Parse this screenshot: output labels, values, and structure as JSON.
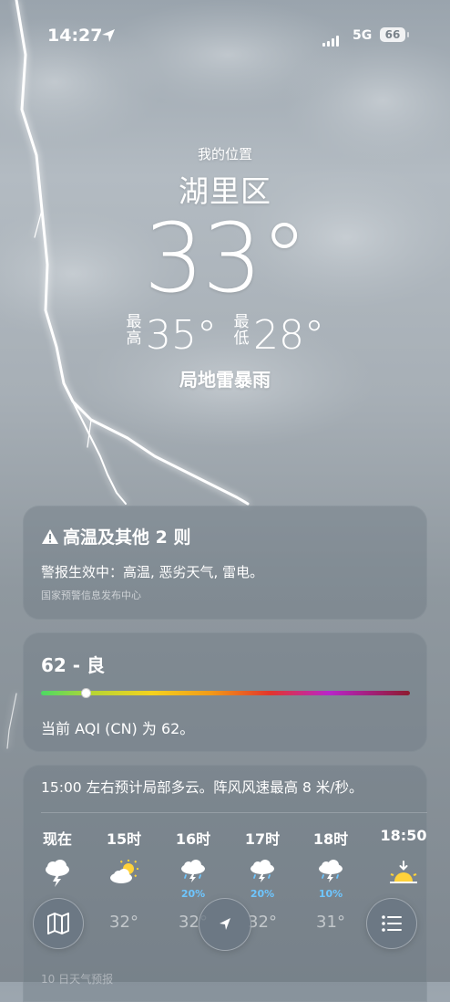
{
  "status_bar": {
    "time": "14:27",
    "network": "5G",
    "battery": "66"
  },
  "header": {
    "location_label": "我的位置",
    "city": "湖里区",
    "temperature": "33°",
    "high_label": "最高",
    "high": "35°",
    "low_label": "最低",
    "low": "28°",
    "condition": "局地雷暴雨"
  },
  "alert": {
    "title": "高温及其他 2 则",
    "description": "警报生效中：高温, 恶劣天气, 雷电。",
    "source": "国家预警信息发布中心"
  },
  "aqi": {
    "value_label": "62 - 良",
    "level": 0.12,
    "description": "当前 AQI (CN) 为 62。"
  },
  "hourly": {
    "summary": "15:00 左右预计局部多云。阵风风速最高 8 米/秒。",
    "items": [
      {
        "time": "现在",
        "icon": "thunderstorm-icon",
        "precip": "",
        "temp": ""
      },
      {
        "time": "15时",
        "icon": "partly-cloudy-sun-icon",
        "precip": "",
        "temp": "32°"
      },
      {
        "time": "16时",
        "icon": "thunder-rain-icon",
        "precip": "20%",
        "temp": "32°"
      },
      {
        "time": "17时",
        "icon": "thunder-rain-icon",
        "precip": "20%",
        "temp": "32°"
      },
      {
        "time": "18时",
        "icon": "thunder-rain-icon",
        "precip": "10%",
        "temp": "31°"
      },
      {
        "time": "18:50",
        "icon": "sunset-icon",
        "precip": "",
        "temp": ""
      }
    ]
  },
  "toolbar": {
    "map": "map-icon",
    "location": "location-arrow-icon",
    "list": "list-icon"
  },
  "next_section": "10 日天气预报"
}
